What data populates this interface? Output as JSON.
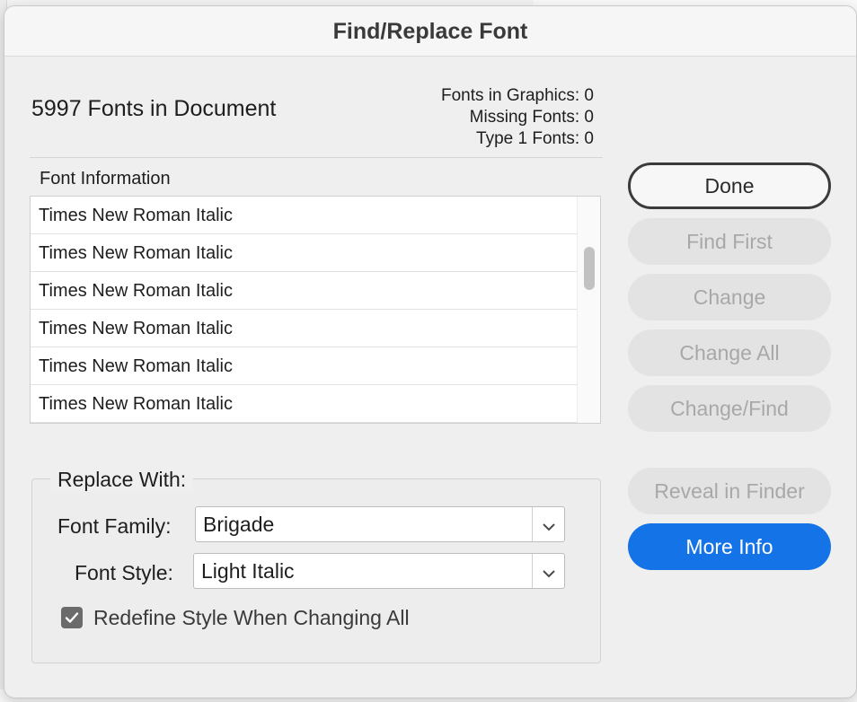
{
  "window": {
    "title": "Find/Replace Font"
  },
  "summary": {
    "count_title": "5997 Fonts in Document",
    "fonts_in_graphics": "Fonts in Graphics: 0",
    "missing_fonts": "Missing Fonts: 0",
    "type1_fonts": "Type 1 Fonts: 0"
  },
  "font_list": {
    "header": "Font Information",
    "rows": [
      "Times New Roman Italic",
      "Times New Roman Italic",
      "Times New Roman Italic",
      "Times New Roman Italic",
      "Times New Roman Italic",
      "Times New Roman Italic"
    ]
  },
  "replace_with": {
    "legend": "Replace With:",
    "font_family_label": "Font Family:",
    "font_family_value": "Brigade",
    "font_style_label": "Font Style:",
    "font_style_value": "Light Italic",
    "redefine_label": "Redefine Style When Changing All",
    "redefine_checked": true
  },
  "buttons": {
    "done": "Done",
    "find_first": "Find First",
    "change": "Change",
    "change_all": "Change All",
    "change_find": "Change/Find",
    "reveal": "Reveal in Finder",
    "more_info": "More Info"
  },
  "colors": {
    "accent": "#1473e6",
    "disabled_text": "#a8a8a8"
  },
  "icons": [
    "chevron-down-icon",
    "checkmark-icon"
  ]
}
